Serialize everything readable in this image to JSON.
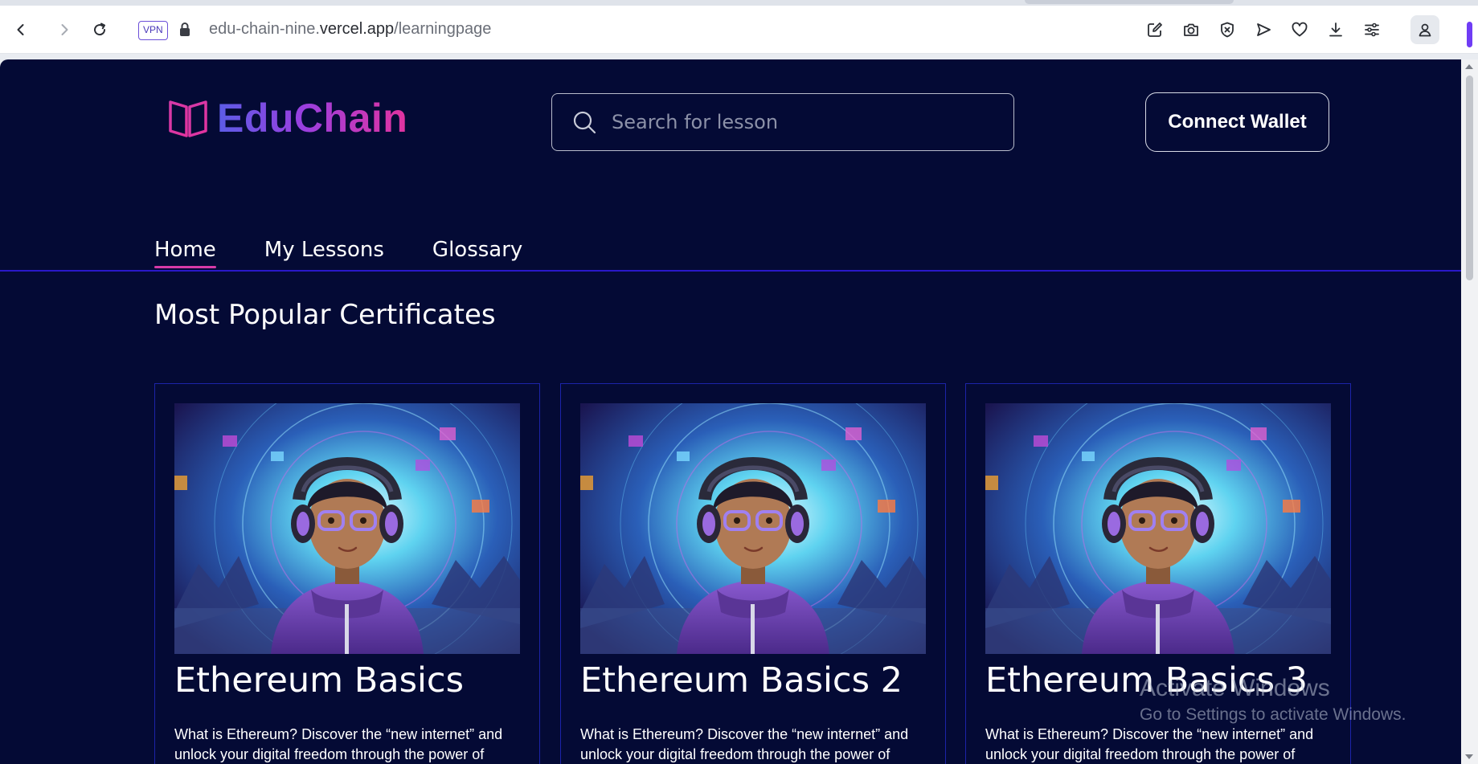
{
  "browser": {
    "vpn_label": "VPN",
    "url_host_prefix": "edu-chain-nine.",
    "url_host_domain": "vercel.app",
    "url_path": "/learningpage",
    "toolbar_icons": [
      "edit-icon",
      "camera-icon",
      "shield-x-icon",
      "send-icon",
      "heart-icon",
      "download-icon",
      "settings-sliders-icon",
      "profile-icon"
    ]
  },
  "header": {
    "logo_text": "EduChain",
    "search_placeholder": "Search for lesson",
    "connect_label": "Connect Wallet"
  },
  "nav": {
    "tabs": [
      {
        "label": "Home",
        "active": true
      },
      {
        "label": "My Lessons",
        "active": false
      },
      {
        "label": "Glossary",
        "active": false
      }
    ]
  },
  "main": {
    "section_title": "Most Popular Certificates",
    "cards": [
      {
        "title": "Ethereum Basics",
        "description": "What is Ethereum? Discover the “new internet” and unlock your digital freedom through the power of"
      },
      {
        "title": "Ethereum Basics 2",
        "description": "What is Ethereum? Discover the “new internet” and unlock your digital freedom through the power of"
      },
      {
        "title": "Ethereum Basics 3",
        "description": "What is Ethereum? Discover the “new internet” and unlock your digital freedom through the power of"
      }
    ]
  },
  "watermark": {
    "line1": "Activate Windows",
    "line2": "Go to Settings to activate Windows."
  },
  "colors": {
    "page_bg": "#040a35",
    "accent_pink": "#d63aa8",
    "tab_line": "#2a18c8",
    "card_border": "#1c23a8",
    "logo_gradient_start": "#5b5ce6",
    "logo_gradient_end": "#e2339f"
  }
}
